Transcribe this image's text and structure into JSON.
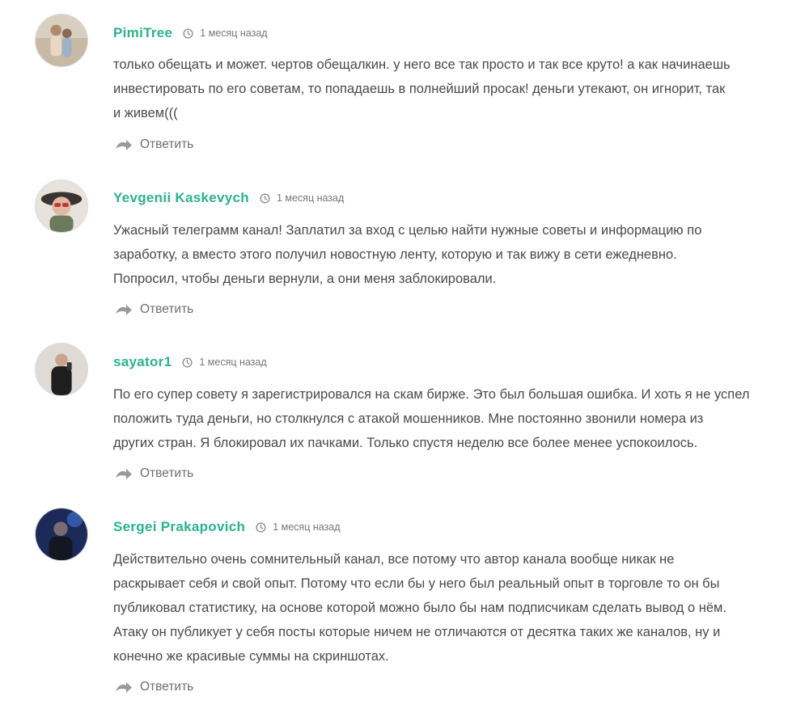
{
  "accent_color": "#2bb38a",
  "reply_label": "Ответить",
  "comments": [
    {
      "author": "PimiTree",
      "time": "1 месяц назад",
      "text_lines": [
        "только обещать и может. чертов обещалкин. у него все так просто и так все круто! а как начинаешь",
        "инвестировать по его советам, то попадаешь в полнейший просак! деньги утекают, он игнорит, так",
        "и живем((("
      ]
    },
    {
      "author": "Yevgenii Kaskevych",
      "time": "1 месяц назад",
      "text_lines": [
        "Ужасный телеграмм канал! Заплатил за вход с целью найти нужные советы и информацию по",
        "заработку, а вместо этого получил новостную ленту, которую и так вижу в сети ежедневно.",
        "Попросил, чтобы деньги вернули, а они меня заблокировали."
      ]
    },
    {
      "author": "sayator1",
      "time": "1 месяц назад",
      "text_lines": [
        "По его супер совету я зарегистрировался на скам бирже. Это был большая ошибка. И хоть я не успел",
        "положить туда деньги, но столкнулся с атакой мошенников. Мне постоянно звонили номера из",
        "других стран. Я блокировал их пачками. Только спустя неделю все более менее успокоилось."
      ]
    },
    {
      "author": "Sergei Prakapovich",
      "time": "1 месяц назад",
      "text_lines": [
        "Действительно очень сомнительный канал, все потому что автор канала вообще никак не",
        "раскрывает себя и свой опыт. Потому что если бы у него был реальный опыт в торговле то он бы",
        "публиковал статистику, на основе которой можно было бы нам подписчикам сделать вывод о нём.",
        "Атаку он публикует у себя посты которые ничем не отличаются от десятка таких же каналов, ну и",
        "конечно же красивые суммы на скриншотах."
      ]
    }
  ]
}
